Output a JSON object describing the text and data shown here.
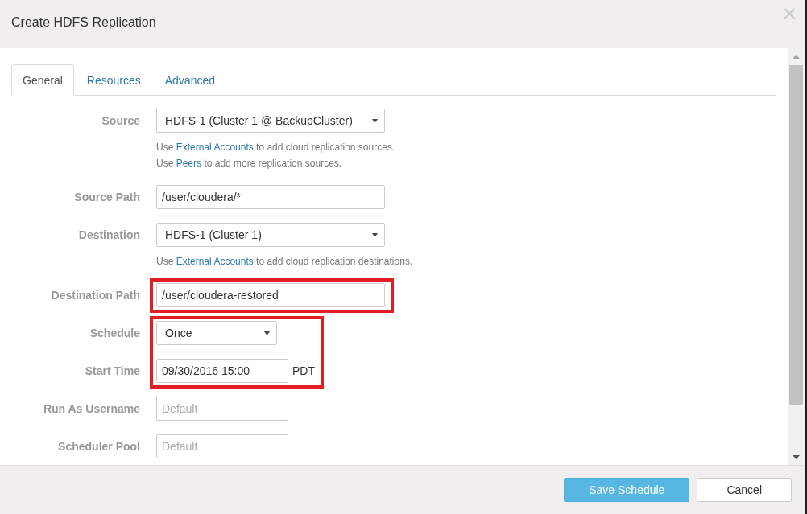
{
  "dialog": {
    "title": "Create HDFS Replication",
    "close_label": "×"
  },
  "tabs": [
    {
      "label": "General",
      "selected": true
    },
    {
      "label": "Resources",
      "selected": false
    },
    {
      "label": "Advanced",
      "selected": false
    }
  ],
  "form": {
    "blocks": [
      {
        "highlighted": false,
        "rows": [
          {
            "label": "Source",
            "kind": "select",
            "value": "HDFS-1 (Cluster 1 @ BackupCluster)",
            "help": [
              {
                "before": "Use ",
                "link": "External Accounts",
                "after": " to add cloud replication sources."
              },
              {
                "before": "Use ",
                "link": "Peers",
                "after": " to add more replication sources."
              }
            ]
          },
          {
            "label": "Source Path",
            "kind": "input",
            "value": "/user/cloudera/*"
          },
          {
            "label": "Destination",
            "kind": "select",
            "value": "HDFS-1 (Cluster 1)",
            "help": [
              {
                "before": "Use ",
                "link": "External Accounts",
                "after": " to add cloud replication destinations."
              }
            ]
          }
        ]
      },
      {
        "highlighted": true,
        "rows": [
          {
            "label": "Destination Path",
            "kind": "input",
            "value": "/user/cloudera-restored"
          }
        ]
      },
      {
        "highlighted": true,
        "rows": [
          {
            "label": "Schedule",
            "kind": "select",
            "value": "Once"
          },
          {
            "label": "Start Time",
            "kind": "input",
            "value": "09/30/2016 15:00",
            "suffix": "PDT"
          }
        ]
      },
      {
        "highlighted": false,
        "rows": [
          {
            "label": "Run As Username",
            "kind": "input",
            "placeholder": "Default"
          },
          {
            "label": "Scheduler Pool",
            "kind": "input",
            "placeholder": "Default"
          }
        ]
      }
    ]
  },
  "footer": {
    "buttons": [
      {
        "label": "Save Schedule",
        "kind": "primary"
      },
      {
        "label": "Cancel",
        "kind": "secondary"
      }
    ]
  }
}
